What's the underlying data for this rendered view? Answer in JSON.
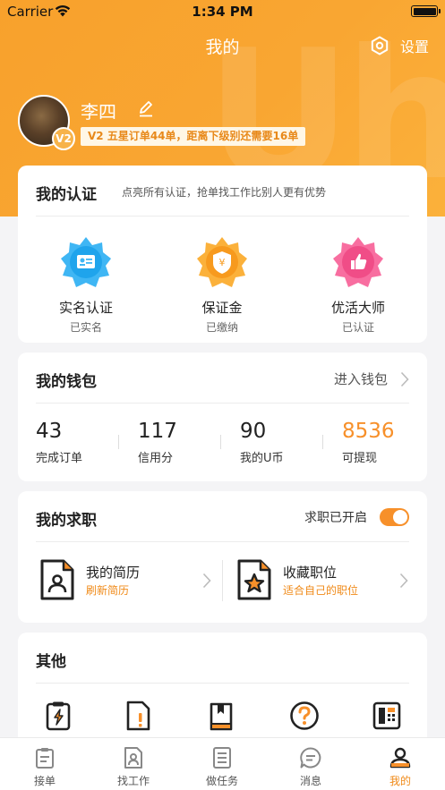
{
  "status_bar": {
    "carrier": "Carrier",
    "time": "1:34 PM"
  },
  "header": {
    "title": "我的",
    "settings_label": "设置",
    "watermark": "Uho"
  },
  "profile": {
    "name": "李四",
    "level": "V2",
    "level_desc": "V2 五星订单44单，距离下级别还需要16单"
  },
  "certification": {
    "title": "我的认证",
    "subtitle": "点亮所有认证，抢单找工作比别人更有优势",
    "items": [
      {
        "name": "实名认证",
        "status": "已实名",
        "icon": "id-card-icon",
        "color": "#3fb6f4"
      },
      {
        "name": "保证金",
        "status": "已缴纳",
        "icon": "deposit-shield-icon",
        "color": "#f9a32d"
      },
      {
        "name": "优活大师",
        "status": "已认证",
        "icon": "thumbs-up-icon",
        "color": "#f45b93"
      }
    ]
  },
  "wallet": {
    "title": "我的钱包",
    "link": "进入钱包",
    "stats": [
      {
        "value": "43",
        "label": "完成订单"
      },
      {
        "value": "117",
        "label": "信用分"
      },
      {
        "value": "90",
        "label": "我的U币"
      },
      {
        "value": "8536",
        "label": "可提现",
        "highlight": true
      }
    ]
  },
  "job": {
    "title": "我的求职",
    "status_label": "求职已开启",
    "enabled": true,
    "items": [
      {
        "title": "我的简历",
        "subtitle": "刷新简历",
        "icon": "resume-icon"
      },
      {
        "title": "收藏职位",
        "subtitle": "适合自己的职位",
        "icon": "favorite-job-icon"
      }
    ]
  },
  "other": {
    "title": "其他",
    "icons": [
      "clipboard-lightning-icon",
      "document-alert-icon",
      "book-icon",
      "help-icon",
      "calculator-icon"
    ]
  },
  "tabbar": {
    "items": [
      {
        "label": "接单",
        "icon": "clipboard-icon"
      },
      {
        "label": "找工作",
        "icon": "resume-tab-icon"
      },
      {
        "label": "做任务",
        "icon": "list-icon"
      },
      {
        "label": "消息",
        "icon": "chat-icon"
      },
      {
        "label": "我的",
        "icon": "user-icon",
        "active": true
      }
    ]
  },
  "colors": {
    "accent": "#f9a32d",
    "highlight": "#f08a18"
  }
}
